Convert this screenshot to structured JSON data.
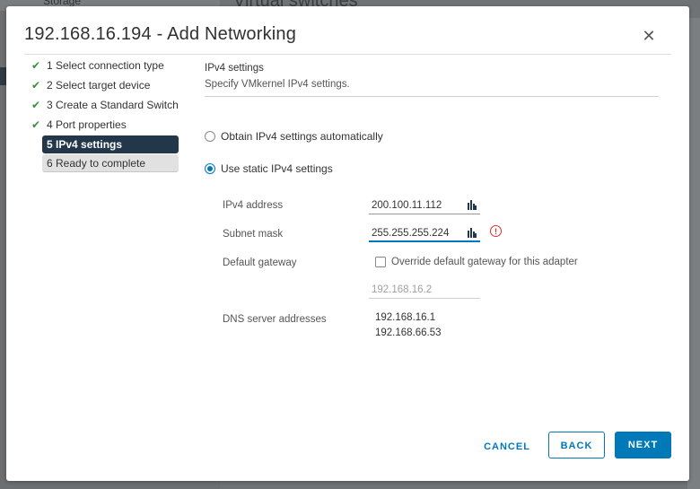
{
  "background": {
    "left_panel_header": "Storage",
    "right_title": "Virtual switches"
  },
  "dialog": {
    "title": "192.168.16.194 - Add Networking",
    "close_icon": "close-icon"
  },
  "steps": [
    {
      "label": "1 Select connection type",
      "state": "done"
    },
    {
      "label": "2 Select target device",
      "state": "done"
    },
    {
      "label": "3 Create a Standard Switch",
      "state": "done"
    },
    {
      "label": "4 Port properties",
      "state": "done"
    },
    {
      "label": "5 IPv4 settings",
      "state": "active"
    },
    {
      "label": "6 Ready to complete",
      "state": "pending"
    }
  ],
  "section": {
    "title": "IPv4 settings",
    "subtitle": "Specify VMkernel IPv4 settings."
  },
  "options": {
    "auto_label": "Obtain IPv4 settings automatically",
    "static_label": "Use static IPv4 settings",
    "selected": "static"
  },
  "fields": {
    "ipv4_label": "IPv4 address",
    "ipv4_value": "200.100.11.112",
    "subnet_label": "Subnet mask",
    "subnet_value": "255.255.255.224",
    "subnet_error": true,
    "gateway_label": "Default gateway",
    "gateway_override_label": "Override default gateway for this adapter",
    "gateway_override_checked": false,
    "gateway_value": "192.168.16.2",
    "dns_label": "DNS server addresses",
    "dns_values": [
      "192.168.16.1",
      "192.168.66.53"
    ]
  },
  "footer": {
    "cancel_label": "CANCEL",
    "back_label": "BACK",
    "next_label": "NEXT"
  },
  "colors": {
    "accent": "#0079b8",
    "active_step_bg": "#22384a",
    "check_green": "#3a8f3a",
    "error_red": "#d9302e"
  }
}
